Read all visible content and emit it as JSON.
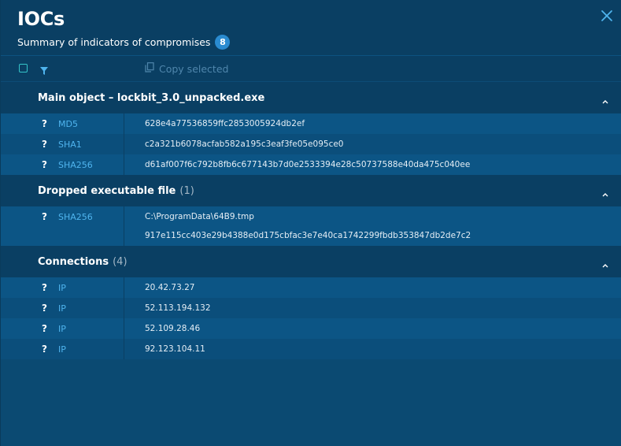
{
  "header": {
    "title": "IOCs",
    "subtitle": "Summary of indicators of compromises",
    "badge_count": "8"
  },
  "toolbar": {
    "copy_label": "Copy selected"
  },
  "sections": [
    {
      "title": "Main object – lockbit_3.0_unpacked.exe",
      "count": "",
      "rows": [
        {
          "q": "?",
          "type": "MD5",
          "value": "628e4a77536859ffc2853005924db2ef"
        },
        {
          "q": "?",
          "type": "SHA1",
          "value": "c2a321b6078acfab582a195c3eaf3fe05e095ce0"
        },
        {
          "q": "?",
          "type": "SHA256",
          "value": "d61af007f6c792b8fb6c677143b7d0e2533394e28c50737588e40da475c040ee"
        }
      ]
    },
    {
      "title": "Dropped executable file",
      "count": "(1)",
      "rows": [
        {
          "q": "?",
          "type": "SHA256",
          "value": "C:\\ProgramData\\64B9.tmp",
          "value2": "917e115cc403e29b4388e0d175cbfac3e7e40ca1742299fbdb353847db2de7c2"
        }
      ]
    },
    {
      "title": "Connections",
      "count": "(4)",
      "rows": [
        {
          "q": "?",
          "type": "IP",
          "value": "20.42.73.27"
        },
        {
          "q": "?",
          "type": "IP",
          "value": "52.113.194.132"
        },
        {
          "q": "?",
          "type": "IP",
          "value": "52.109.28.46"
        },
        {
          "q": "?",
          "type": "IP",
          "value": "92.123.104.11"
        }
      ]
    }
  ]
}
